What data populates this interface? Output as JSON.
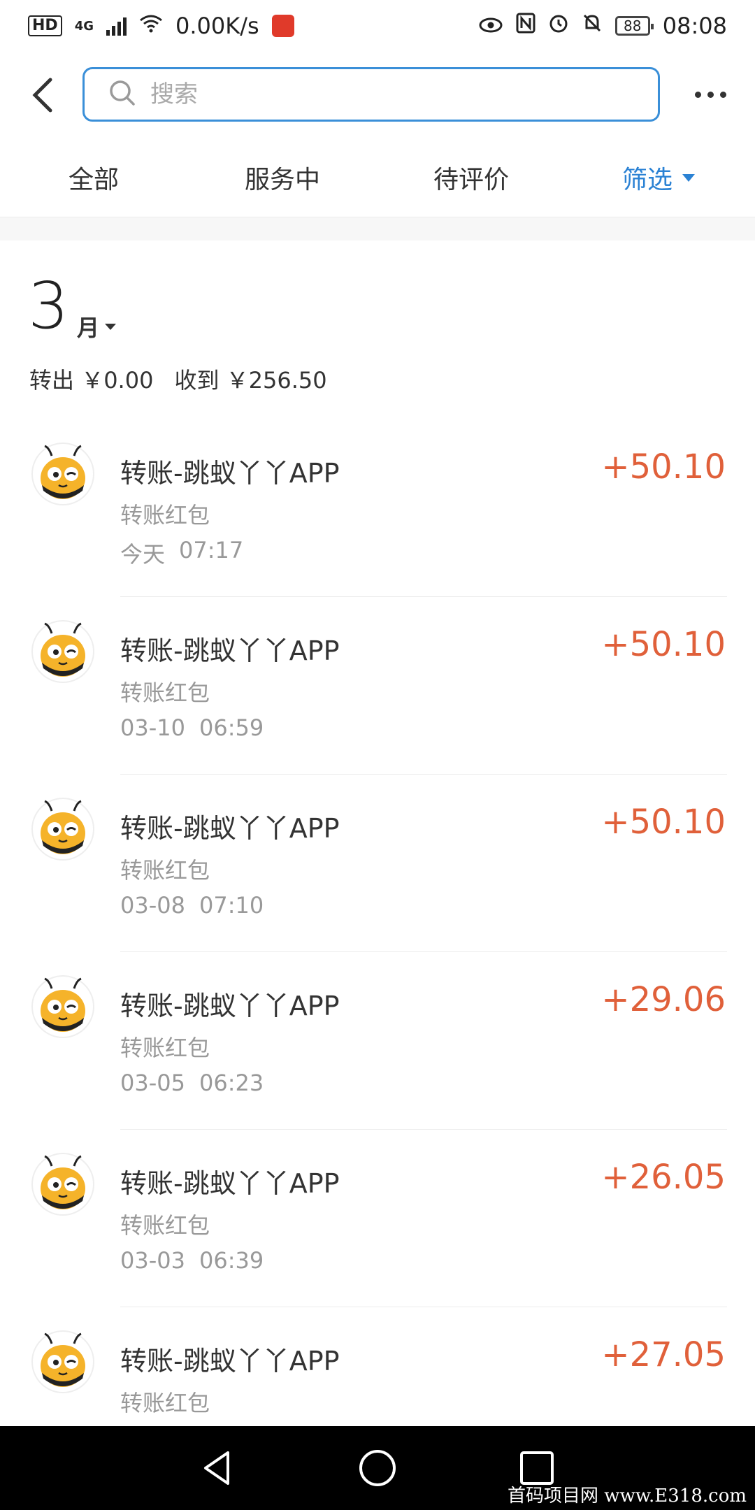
{
  "status_bar": {
    "hd": "HD",
    "network": "4G",
    "speed": "0.00K/s",
    "battery": "88",
    "time": "08:08",
    "icons": [
      "eye-icon",
      "nfc-icon",
      "alarm-icon",
      "mute-bell-icon"
    ]
  },
  "search": {
    "placeholder": "搜索"
  },
  "tabs": [
    {
      "label": "全部"
    },
    {
      "label": "服务中"
    },
    {
      "label": "待评价"
    },
    {
      "label": "筛选"
    }
  ],
  "month": {
    "number": "3",
    "unit": "月",
    "out_label": "转出",
    "out_amount": "￥0.00",
    "in_label": "收到",
    "in_amount": "￥256.50"
  },
  "transactions": [
    {
      "title": "转账-跳蚁丫丫APP",
      "subtitle": "转账红包",
      "date": "今天",
      "time": "07:17",
      "amount": "+50.10"
    },
    {
      "title": "转账-跳蚁丫丫APP",
      "subtitle": "转账红包",
      "date": "03-10",
      "time": "06:59",
      "amount": "+50.10"
    },
    {
      "title": "转账-跳蚁丫丫APP",
      "subtitle": "转账红包",
      "date": "03-08",
      "time": "07:10",
      "amount": "+50.10"
    },
    {
      "title": "转账-跳蚁丫丫APP",
      "subtitle": "转账红包",
      "date": "03-05",
      "time": "06:23",
      "amount": "+29.06"
    },
    {
      "title": "转账-跳蚁丫丫APP",
      "subtitle": "转账红包",
      "date": "03-03",
      "time": "06:39",
      "amount": "+26.05"
    },
    {
      "title": "转账-跳蚁丫丫APP",
      "subtitle": "转账红包",
      "date": "",
      "time": "",
      "amount": "+27.05"
    }
  ],
  "watermark": "首码项目网 www.E318.com",
  "colors": {
    "accent": "#2b82d4",
    "amount": "#e0603a",
    "nav": "#000000"
  }
}
